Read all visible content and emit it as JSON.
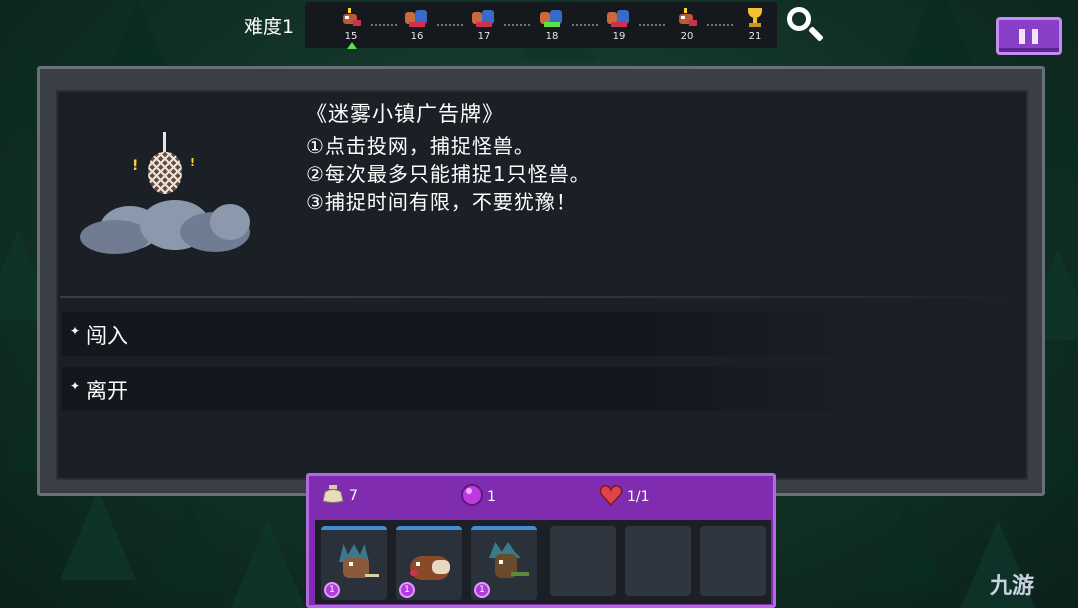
{
  "header": {
    "difficulty_label": "难度1",
    "levels": [
      {
        "num": "15",
        "icon": "boss-sprite-icon",
        "current": true,
        "alert": true
      },
      {
        "num": "16",
        "icon": "battle-sprite-icon"
      },
      {
        "num": "17",
        "icon": "battle-sprite-icon"
      },
      {
        "num": "18",
        "icon": "battle-sprite-icon"
      },
      {
        "num": "19",
        "icon": "battle-sprite-icon"
      },
      {
        "num": "20",
        "icon": "boss-sprite-icon",
        "alert": true
      },
      {
        "num": "21",
        "icon": "trophy-icon"
      }
    ],
    "search_icon": "search-icon",
    "pause_icon": "pause-icon"
  },
  "event": {
    "title": "《迷雾小镇广告牌》",
    "rules": [
      "①点击投网，捕捉怪兽。",
      "②每次最多只能捕捉1只怪兽。",
      "③捕捉时间有限，不要犹豫！"
    ],
    "options": [
      {
        "bullet": "✦",
        "label": "闯入"
      },
      {
        "bullet": "✦",
        "label": "离开"
      }
    ]
  },
  "inventory": {
    "potions": "7",
    "orbs": "1",
    "hearts": "1/1",
    "slots": [
      {
        "filled": true,
        "level": "1",
        "icon": "hedgehog-monster-icon"
      },
      {
        "filled": true,
        "level": "1",
        "icon": "boar-monster-icon"
      },
      {
        "filled": true,
        "level": "1",
        "icon": "tree-monster-icon"
      },
      {
        "filled": false
      },
      {
        "filled": false
      },
      {
        "filled": false
      }
    ]
  },
  "watermark": "九游",
  "colors": {
    "accent_purple": "#8a3fc8",
    "panel": "#1b2027",
    "current_marker": "#5de04a"
  }
}
